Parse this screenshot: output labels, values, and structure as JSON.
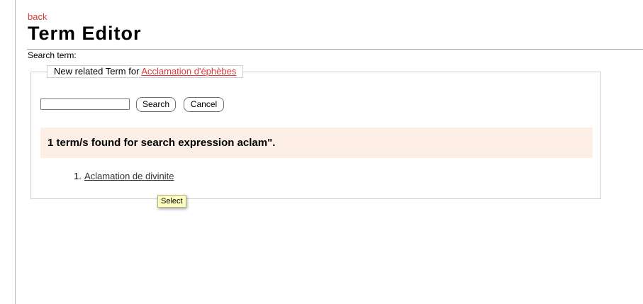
{
  "header": {
    "back_label": "back",
    "title": "Term Editor"
  },
  "search": {
    "label": "Search term:",
    "input_value": "",
    "search_button": "Search",
    "cancel_button": "Cancel"
  },
  "fieldset": {
    "legend_prefix": "New related Term for ",
    "legend_link": "Acclamation d'éphèbes"
  },
  "results": {
    "message": "1 term/s found for search expression aclam\".",
    "items": [
      {
        "number": "1.",
        "label": "Aclamation de divinite"
      }
    ]
  },
  "tooltip": {
    "text": "Select"
  },
  "colors": {
    "link_red": "#d93b3b",
    "result_bg": "#fdefe6",
    "tooltip_bg": "#fdfdc0"
  }
}
